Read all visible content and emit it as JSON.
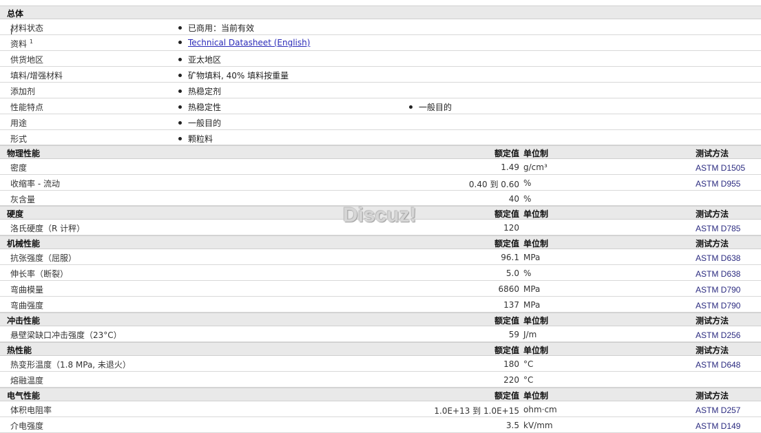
{
  "general": {
    "title": "总体",
    "rows": [
      {
        "label": "材料状态",
        "items": [
          "已商用：当前有效"
        ]
      },
      {
        "label": "资料",
        "sup": "1",
        "link": "Technical Datasheet (English)"
      },
      {
        "label": "供货地区",
        "items": [
          "亚太地区"
        ]
      },
      {
        "label": "填料/增强材料",
        "items": [
          "矿物填料, 40% 填料按重量"
        ]
      },
      {
        "label": "添加剂",
        "items": [
          "热稳定剂"
        ]
      },
      {
        "label": "性能特点",
        "items": [
          "热稳定性",
          "一般目的"
        ]
      },
      {
        "label": "用途",
        "items": [
          "一般目的"
        ]
      },
      {
        "label": "形式",
        "items": [
          "颗粒料"
        ]
      }
    ]
  },
  "col_headers": {
    "value": "额定值",
    "unit": "单位制",
    "method": "测试方法"
  },
  "sections": [
    {
      "title": "物理性能",
      "rows": [
        {
          "label": "密度",
          "value": "1.49",
          "unit": "g/cm³",
          "method": "ASTM D1505"
        },
        {
          "label": "收缩率 - 流动",
          "value": "0.40 到  0.60",
          "unit": "%",
          "method": "ASTM D955"
        },
        {
          "label": "灰含量",
          "value": "40",
          "unit": "%",
          "method": ""
        }
      ]
    },
    {
      "title": "硬度",
      "rows": [
        {
          "label": "洛氏硬度（R 计秤）",
          "value": "120",
          "unit": "",
          "method": "ASTM D785"
        }
      ]
    },
    {
      "title": "机械性能",
      "rows": [
        {
          "label": "抗张强度（屈服）",
          "value": "96.1",
          "unit": "MPa",
          "method": "ASTM D638"
        },
        {
          "label": "伸长率（断裂）",
          "value": "5.0",
          "unit": "%",
          "method": "ASTM D638"
        },
        {
          "label": "弯曲模量",
          "value": "6860",
          "unit": "MPa",
          "method": "ASTM D790"
        },
        {
          "label": "弯曲强度",
          "value": "137",
          "unit": "MPa",
          "method": "ASTM D790"
        }
      ]
    },
    {
      "title": "冲击性能",
      "rows": [
        {
          "label": "悬壁梁缺口冲击强度（23°C）",
          "value": "59",
          "unit": "J/m",
          "method": "ASTM D256"
        }
      ]
    },
    {
      "title": "热性能",
      "rows": [
        {
          "label": "热变形温度（1.8 MPa, 未退火）",
          "value": "180",
          "unit": "°C",
          "method": "ASTM D648"
        },
        {
          "label": "熔融温度",
          "value": "220",
          "unit": "°C",
          "method": ""
        }
      ]
    },
    {
      "title": "电气性能",
      "rows": [
        {
          "label": "体积电阻率",
          "value": "1.0E+13 到  1.0E+15",
          "unit": "ohm·cm",
          "method": "ASTM D257"
        },
        {
          "label": "介电强度",
          "value": "3.5",
          "unit": "kV/mm",
          "method": "ASTM D149"
        }
      ]
    }
  ],
  "watermark": "Discuz!",
  "cursor_glyph": "I"
}
